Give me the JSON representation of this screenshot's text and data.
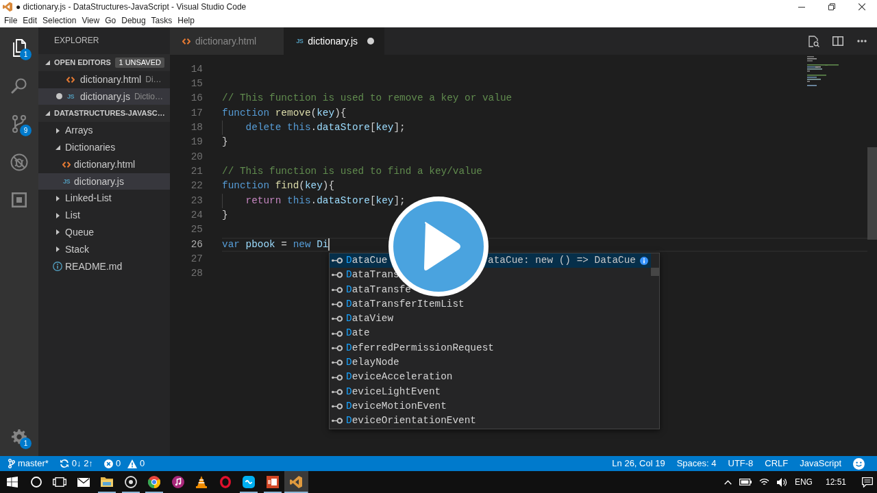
{
  "window": {
    "title": "● dictionary.js - DataStructures-JavaScript - Visual Studio Code"
  },
  "menu": [
    "File",
    "Edit",
    "Selection",
    "View",
    "Go",
    "Debug",
    "Tasks",
    "Help"
  ],
  "activity_bar": {
    "items": [
      {
        "kind": "explorer",
        "selected": true,
        "badge": "1"
      },
      {
        "kind": "search",
        "selected": false
      },
      {
        "kind": "source_control",
        "selected": false,
        "badge": "9"
      },
      {
        "kind": "debug",
        "selected": false
      },
      {
        "kind": "extensions",
        "selected": false
      }
    ],
    "settings_badge": "1"
  },
  "sidebar": {
    "title": "EXPLORER",
    "open_editors": {
      "title": "OPEN EDITORS",
      "expanded": true,
      "badge": "1 UNSAVED",
      "items": [
        {
          "kind": "html",
          "name": "dictionary.html",
          "description": "Di…",
          "unsaved": false,
          "selected": false
        },
        {
          "kind": "js",
          "icon_label": "JS",
          "name": "dictionary.js",
          "description": "Dictio…",
          "unsaved": true,
          "selected": true
        }
      ]
    },
    "folder": {
      "title": "DATASTRUCTURES-JAVASC…",
      "expanded": true,
      "items": [
        {
          "kind": "folder",
          "name": "Arrays",
          "expanded": false,
          "selected": false
        },
        {
          "kind": "folder",
          "name": "Dictionaries",
          "expanded": true,
          "selected": false,
          "children": [
            {
              "kind": "html",
              "name": "dictionary.html",
              "selected": false
            },
            {
              "kind": "js",
              "icon_label": "JS",
              "name": "dictionary.js",
              "selected": true
            }
          ]
        },
        {
          "kind": "folder",
          "name": "Linked-List",
          "expanded": false,
          "selected": false
        },
        {
          "kind": "folder",
          "name": "List",
          "expanded": false,
          "selected": false
        },
        {
          "kind": "folder",
          "name": "Queue",
          "expanded": false,
          "selected": false
        },
        {
          "kind": "folder",
          "name": "Stack",
          "expanded": false,
          "selected": false
        },
        {
          "kind": "info",
          "name": "README.md",
          "selected": false
        }
      ]
    }
  },
  "editor": {
    "tabs": [
      {
        "kind": "html",
        "name": "dictionary.html",
        "selected": false,
        "unsaved": false
      },
      {
        "kind": "js",
        "icon_label": "JS",
        "name": "dictionary.js",
        "selected": true,
        "unsaved": true
      }
    ],
    "lines": [
      {
        "number": "14",
        "current": false,
        "guide": false
      },
      {
        "number": "15",
        "current": false,
        "guide": false
      },
      {
        "number": "16",
        "current": false,
        "guide": false,
        "tokens": [
          {
            "kind": "comment",
            "text": "// This function is used to remove a key or value"
          }
        ]
      },
      {
        "number": "17",
        "current": false,
        "guide": false,
        "tokens": [
          {
            "kind": "keyword",
            "text": "function "
          },
          {
            "kind": "function",
            "text": "remove"
          },
          {
            "kind": "plain",
            "text": "("
          },
          {
            "kind": "variable",
            "text": "key"
          },
          {
            "kind": "plain",
            "text": "){"
          }
        ]
      },
      {
        "number": "18",
        "current": false,
        "guide": true,
        "tokens": [
          {
            "kind": "keyword",
            "text": "    delete this"
          },
          {
            "kind": "plain",
            "text": "."
          },
          {
            "kind": "variable",
            "text": "dataStore"
          },
          {
            "kind": "plain",
            "text": "["
          },
          {
            "kind": "variable",
            "text": "key"
          },
          {
            "kind": "plain",
            "text": "];"
          }
        ]
      },
      {
        "number": "19",
        "current": false,
        "guide": false,
        "tokens": [
          {
            "kind": "plain",
            "text": "}"
          }
        ]
      },
      {
        "number": "20",
        "current": false,
        "guide": false
      },
      {
        "number": "21",
        "current": false,
        "guide": false,
        "tokens": [
          {
            "kind": "comment",
            "text": "// This function is used to find a key/value"
          }
        ]
      },
      {
        "number": "22",
        "current": false,
        "guide": false,
        "tokens": [
          {
            "kind": "keyword",
            "text": "function "
          },
          {
            "kind": "function",
            "text": "find"
          },
          {
            "kind": "plain",
            "text": "("
          },
          {
            "kind": "variable",
            "text": "key"
          },
          {
            "kind": "plain",
            "text": "){"
          }
        ]
      },
      {
        "number": "23",
        "current": false,
        "guide": true,
        "tokens": [
          {
            "kind": "control",
            "text": "    return "
          },
          {
            "kind": "keyword",
            "text": "this"
          },
          {
            "kind": "plain",
            "text": "."
          },
          {
            "kind": "variable",
            "text": "dataStore"
          },
          {
            "kind": "plain",
            "text": "["
          },
          {
            "kind": "variable",
            "text": "key"
          },
          {
            "kind": "plain",
            "text": "];"
          }
        ]
      },
      {
        "number": "24",
        "current": false,
        "guide": false,
        "tokens": [
          {
            "kind": "plain",
            "text": "}"
          }
        ]
      },
      {
        "number": "25",
        "current": false,
        "guide": false
      },
      {
        "number": "26",
        "current": true,
        "guide": false,
        "tokens": [
          {
            "kind": "keyword",
            "text": "var "
          },
          {
            "kind": "variable",
            "text": "pbook"
          },
          {
            "kind": "plain",
            "text": " = "
          },
          {
            "kind": "keyword",
            "text": "new "
          },
          {
            "kind": "variable",
            "text": "Di"
          }
        ]
      },
      {
        "number": "27",
        "current": false,
        "guide": false
      },
      {
        "number": "28",
        "current": false,
        "guide": false
      }
    ],
    "suggestions": [
      {
        "label": "DataCue",
        "selected": true,
        "detail": "ataCue: new () => DataCue"
      },
      {
        "label": "DataTrans",
        "selected": false
      },
      {
        "label": "DataTransfe",
        "selected": false
      },
      {
        "label": "DataTransferItemList",
        "selected": false
      },
      {
        "label": "DataView",
        "selected": false
      },
      {
        "label": "Date",
        "selected": false
      },
      {
        "label": "DeferredPermissionRequest",
        "selected": false
      },
      {
        "label": "DelayNode",
        "selected": false
      },
      {
        "label": "DeviceAcceleration",
        "selected": false
      },
      {
        "label": "DeviceLightEvent",
        "selected": false
      },
      {
        "label": "DeviceMotionEvent",
        "selected": false
      },
      {
        "label": "DeviceOrientationEvent",
        "selected": false
      }
    ]
  },
  "status_bar": {
    "branch": "master*",
    "sync": "0↓ 2↑",
    "errors": "0",
    "warnings": "0",
    "items": [
      "Ln 26, Col 19",
      "Spaces: 4",
      "UTF-8",
      "CRLF",
      "JavaScript"
    ]
  },
  "taskbar": {
    "apps": [
      {
        "kind": "mail",
        "selected": false,
        "running": false
      },
      {
        "kind": "files",
        "selected": false,
        "running": true
      },
      {
        "kind": "media",
        "selected": false,
        "running": true
      },
      {
        "kind": "browser",
        "selected": false,
        "running": true
      },
      {
        "kind": "music",
        "selected": false,
        "running": false
      },
      {
        "kind": "cone",
        "selected": false,
        "running": false
      },
      {
        "kind": "ring",
        "selected": false,
        "running": false
      },
      {
        "kind": "chat",
        "selected": false,
        "running": true
      },
      {
        "kind": "slides",
        "selected": false,
        "running": true
      },
      {
        "kind": "editor",
        "selected": true,
        "running": true
      }
    ],
    "language": "ENG",
    "time": "12:51"
  }
}
